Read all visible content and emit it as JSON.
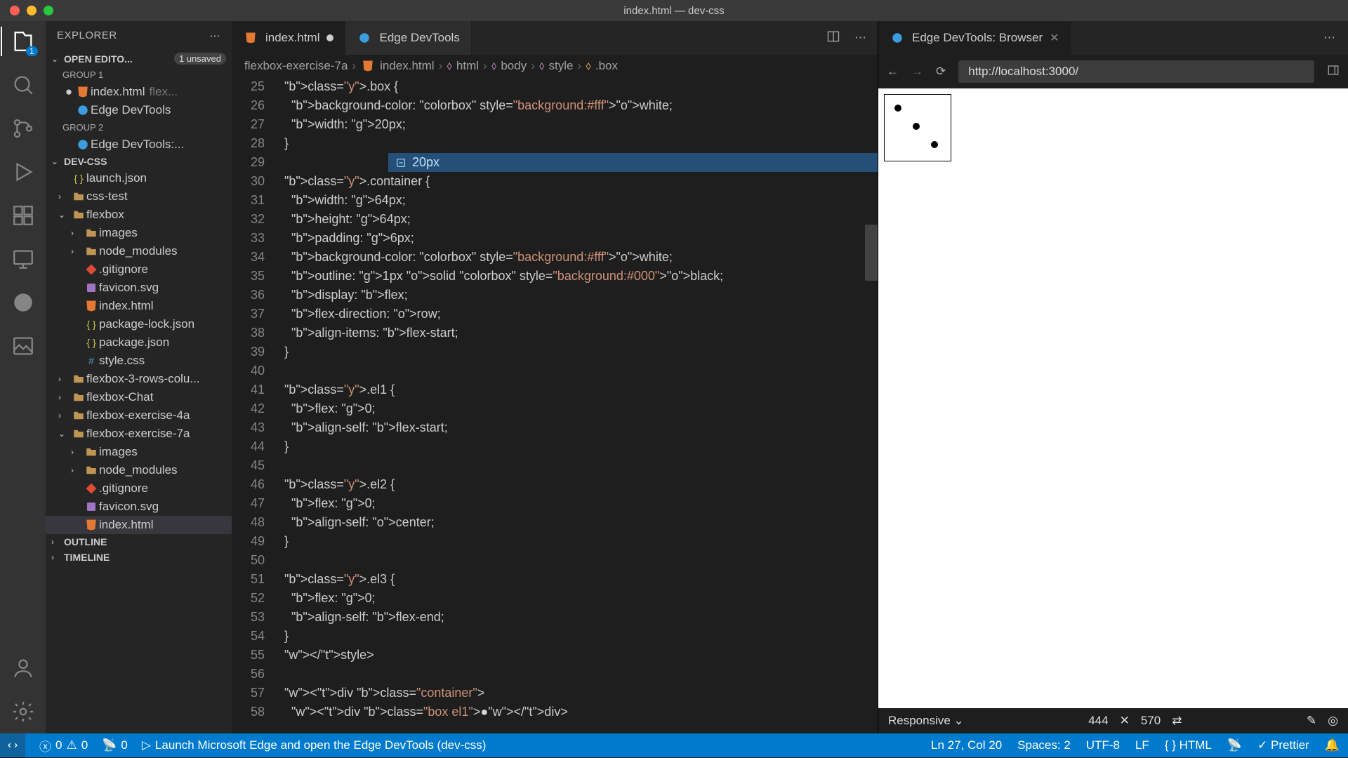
{
  "window": {
    "title": "index.html — dev-css"
  },
  "sidebar": {
    "title": "EXPLORER",
    "open_editors": {
      "label": "OPEN EDITO...",
      "badge": "1 unsaved"
    },
    "groups": [
      "GROUP 1",
      "GROUP 2"
    ],
    "g1_items": [
      {
        "name": "index.html",
        "suffix": "flex..."
      },
      {
        "name": "Edge DevTools"
      }
    ],
    "g2_items": [
      {
        "name": "Edge DevTools:..."
      }
    ],
    "project": "DEV-CSS",
    "tree": [
      {
        "i": 0,
        "n": "launch.json",
        "k": "json"
      },
      {
        "i": 0,
        "n": "css-test",
        "k": "fold",
        "ch": ">"
      },
      {
        "i": 0,
        "n": "flexbox",
        "k": "fold",
        "ch": "v"
      },
      {
        "i": 1,
        "n": "images",
        "k": "fold",
        "ch": ">"
      },
      {
        "i": 1,
        "n": "node_modules",
        "k": "fold",
        "ch": ">"
      },
      {
        "i": 1,
        "n": ".gitignore",
        "k": "git"
      },
      {
        "i": 1,
        "n": "favicon.svg",
        "k": "svg"
      },
      {
        "i": 1,
        "n": "index.html",
        "k": "html"
      },
      {
        "i": 1,
        "n": "package-lock.json",
        "k": "json"
      },
      {
        "i": 1,
        "n": "package.json",
        "k": "json"
      },
      {
        "i": 1,
        "n": "style.css",
        "k": "css"
      },
      {
        "i": 0,
        "n": "flexbox-3-rows-colu...",
        "k": "fold",
        "ch": ">"
      },
      {
        "i": 0,
        "n": "flexbox-Chat",
        "k": "fold",
        "ch": ">"
      },
      {
        "i": 0,
        "n": "flexbox-exercise-4a",
        "k": "fold",
        "ch": ">"
      },
      {
        "i": 0,
        "n": "flexbox-exercise-7a",
        "k": "fold",
        "ch": "v"
      },
      {
        "i": 1,
        "n": "images",
        "k": "fold",
        "ch": ">"
      },
      {
        "i": 1,
        "n": "node_modules",
        "k": "fold",
        "ch": ">"
      },
      {
        "i": 1,
        "n": ".gitignore",
        "k": "git"
      },
      {
        "i": 1,
        "n": "favicon.svg",
        "k": "svg"
      },
      {
        "i": 1,
        "n": "index.html",
        "k": "html",
        "sel": true
      }
    ],
    "outline": "OUTLINE",
    "timeline": "TIMELINE"
  },
  "tabs": [
    {
      "name": "index.html",
      "kind": "html",
      "dirty": true
    },
    {
      "name": "Edge DevTools",
      "kind": "edge"
    }
  ],
  "breadcrumb": [
    "flexbox-exercise-7a",
    "index.html",
    "html",
    "body",
    "style",
    ".box"
  ],
  "code": {
    "start": 25,
    "lines": [
      ".box {",
      "  background-color: ■white;",
      "  width: 20px;",
      "}",
      "",
      ".container {",
      "  width: 64px;",
      "  height: 64px;",
      "  padding: 6px;",
      "  background-color: ■white;",
      "  outline: 1px solid □black;",
      "  display: flex;",
      "  flex-direction: row;",
      "  align-items: flex-start;",
      "}",
      "",
      ".el1 {",
      "  flex: 0;",
      "  align-self: flex-start;",
      "}",
      "",
      ".el2 {",
      "  flex: 0;",
      "  align-self: center;",
      "}",
      "",
      ".el3 {",
      "  flex: 0;",
      "  align-self: flex-end;",
      "}",
      "</style>",
      "",
      "<div class=\"container\">",
      "  <div class=\"box el1\">●</div>"
    ],
    "hint": "20px"
  },
  "panel2": {
    "tab": "Edge DevTools: Browser",
    "url": "http://localhost:3000/",
    "responsive": {
      "label": "Responsive",
      "w": "444",
      "h": "570"
    }
  },
  "status": {
    "errors": "0",
    "warnings": "0",
    "ports": "0",
    "launch": "Launch Microsoft Edge and open the Edge DevTools (dev-css)",
    "pos": "Ln 27, Col 20",
    "spaces": "Spaces: 2",
    "enc": "UTF-8",
    "eol": "LF",
    "lang": "HTML",
    "prettier": "Prettier"
  }
}
